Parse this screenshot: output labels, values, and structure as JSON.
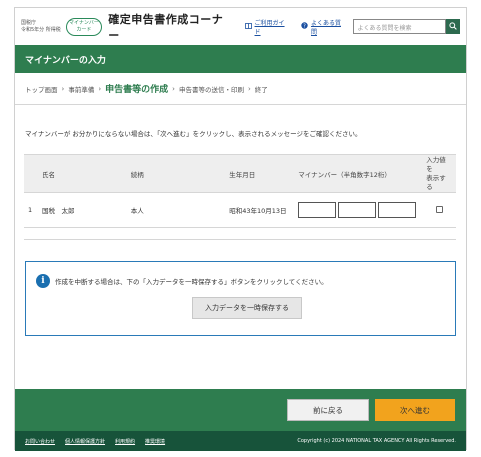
{
  "header": {
    "agency_line1": "国税庁",
    "agency_line2": "令和5年分 所得税",
    "mynumber_card_line1": "マイナンバー",
    "mynumber_card_line2": "カード",
    "corner_title": "確定申告書作成コーナー",
    "guide_link": "ご利用ガイド",
    "faq_link": "よくある質問",
    "search_placeholder": "よくある質問を検索"
  },
  "page_title": "マイナンバーの入力",
  "breadcrumb": [
    "トップ画面",
    "事前準備",
    "申告書等の作成",
    "申告書等の送信・印刷",
    "終了"
  ],
  "instruction": "マイナンバーが お分かりにならない場合は、「次へ進む」をクリックし、表示されるメッセージをご確認ください。",
  "table": {
    "headers": {
      "name": "氏名",
      "relation": "続柄",
      "birth": "生年月日",
      "mynumber": "マイナンバー（半角数字12桁）",
      "show_line1": "入力値を",
      "show_line2": "表示する"
    },
    "rows": [
      {
        "no": "1",
        "name": "国税　太郎",
        "relation": "本人",
        "birth": "昭和43年10月13日"
      }
    ]
  },
  "info_box": {
    "message": "作成を中断する場合は、下の「入力データを一時保存する」ボタンをクリックしてください。",
    "save_button": "入力データを一時保存する"
  },
  "nav": {
    "back_button": "前に戻る",
    "next_button": "次へ進む"
  },
  "footer": {
    "links": [
      "お問い合わせ",
      "個人情報保護方針",
      "利用規約",
      "推奨環境"
    ],
    "copyright": "Copyright (c) 2024 NATIONAL TAX AGENCY All Rights Reserved."
  },
  "colors": {
    "primary_green": "#2e7d4f",
    "footer_green": "#17533a",
    "next_orange": "#f2a31d",
    "info_blue": "#1a6fb0"
  }
}
